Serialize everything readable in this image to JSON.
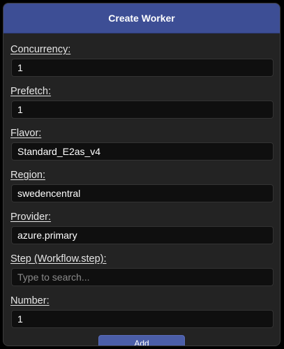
{
  "dialog": {
    "title": "Create Worker",
    "fields": [
      {
        "label": "Concurrency:",
        "value": "1",
        "placeholder": ""
      },
      {
        "label": "Prefetch:",
        "value": "1",
        "placeholder": ""
      },
      {
        "label": "Flavor:",
        "value": "Standard_E2as_v4",
        "placeholder": ""
      },
      {
        "label": "Region:",
        "value": "swedencentral",
        "placeholder": ""
      },
      {
        "label": "Provider:",
        "value": "azure.primary",
        "placeholder": ""
      },
      {
        "label": "Step (Workflow.step):",
        "value": "",
        "placeholder": "Type to search..."
      },
      {
        "label": "Number:",
        "value": "1",
        "placeholder": ""
      }
    ],
    "add_label": "Add"
  }
}
